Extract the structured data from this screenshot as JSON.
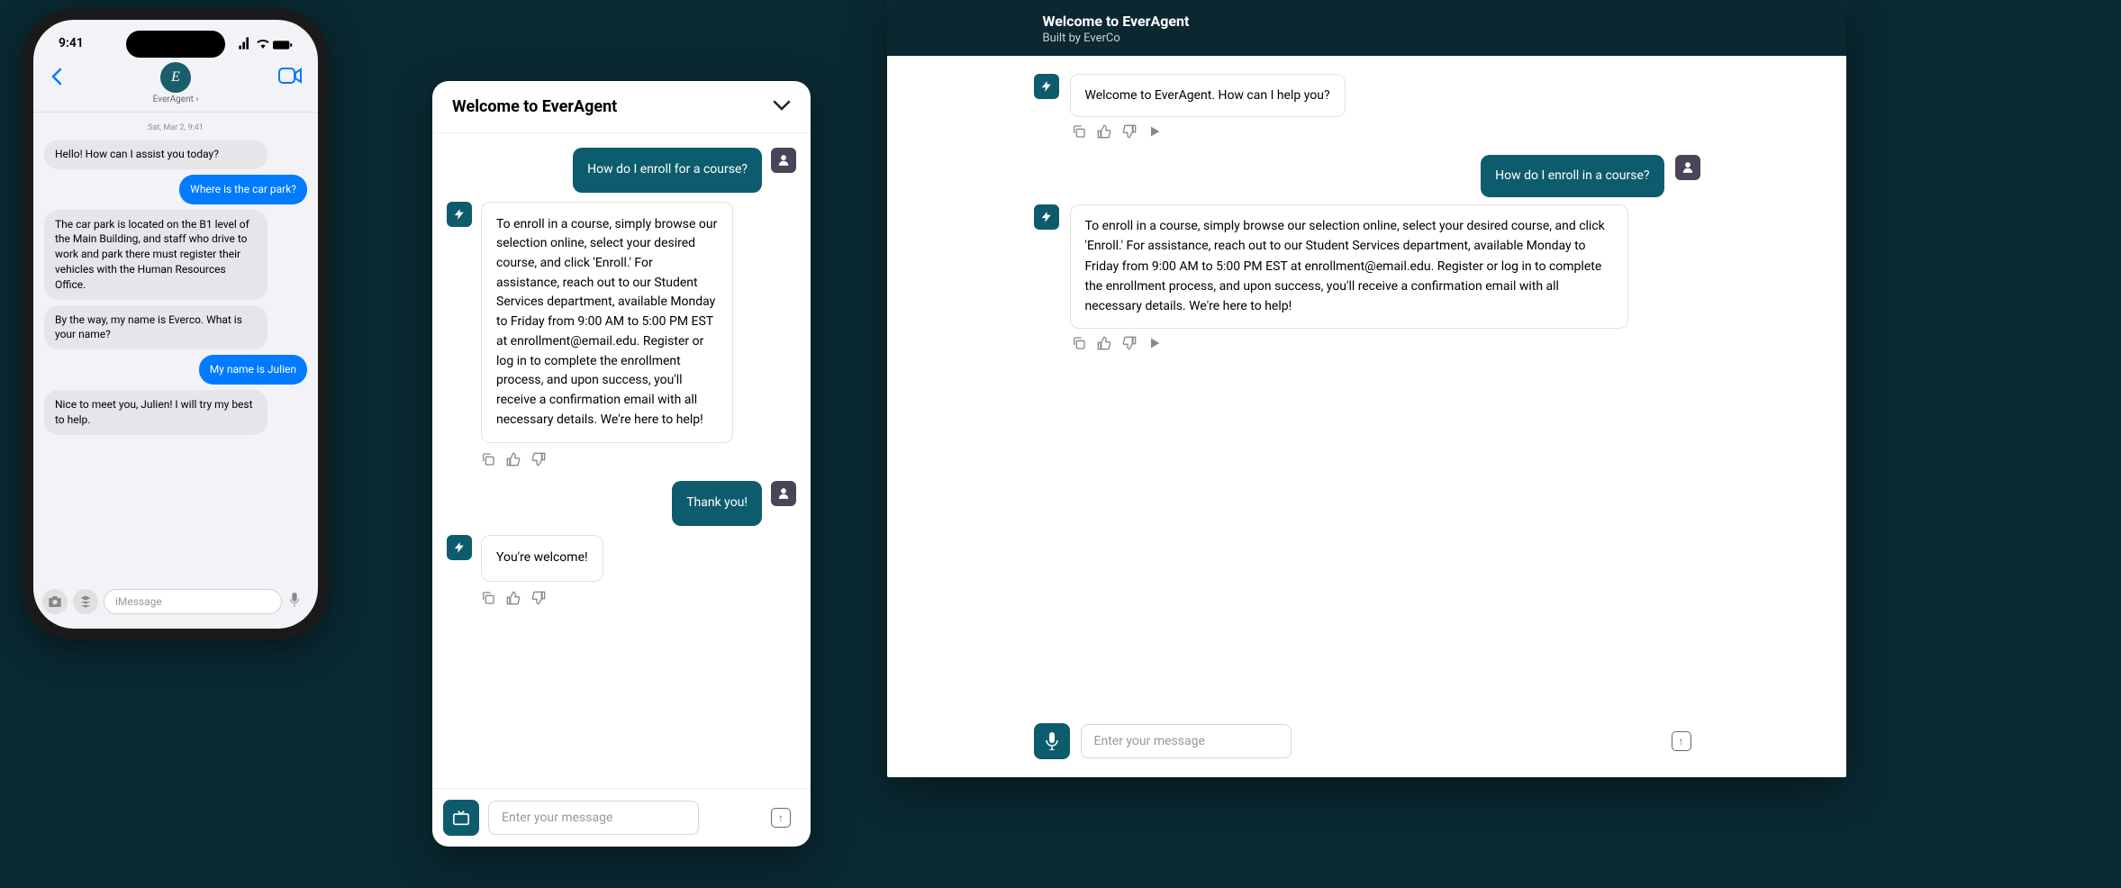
{
  "colors": {
    "accent": "#0d5c6e",
    "ios_blue": "#007aff",
    "bubble_gray": "#e5e5ea",
    "dark_bg": "#0b2730"
  },
  "phone": {
    "status_time": "9:41",
    "contact_name": "EverAgent",
    "date": "Sat, Mar 2, 9:41",
    "messages": [
      {
        "role": "in",
        "text": "Hello! How can I assist you today?"
      },
      {
        "role": "out",
        "text": "Where is the car park?"
      },
      {
        "role": "in",
        "text": "The car park is located on the B1 level of the Main Building, and staff who drive to work and park there must register their vehicles with the Human Resources Office."
      },
      {
        "role": "in",
        "text": "By the way, my name is Everco. What is your name?"
      },
      {
        "role": "out",
        "text": "My name is Julien"
      },
      {
        "role": "in",
        "text": "Nice to meet you, Julien! I will try my best to help."
      }
    ],
    "input_placeholder": "iMessage"
  },
  "widget": {
    "title": "Welcome to EverAgent",
    "messages": [
      {
        "role": "user",
        "text": "How do I enroll for a course?"
      },
      {
        "role": "agent",
        "text": "To enroll in a course, simply browse our selection online, select your desired course, and click 'Enroll.' For assistance, reach out to our Student Services department, available Monday to Friday from 9:00 AM to 5:00 PM EST at enrollment@email.edu. Register or log in to complete the enrollment process, and upon success, you'll receive a confirmation email with all necessary details. We're here to help!"
      },
      {
        "role": "user",
        "text": "Thank you!"
      },
      {
        "role": "agent",
        "text": "You're welcome!"
      }
    ],
    "input_placeholder": "Enter your message"
  },
  "panel": {
    "title": "Welcome to EverAgent",
    "subtitle": "Built by EverCo",
    "messages": [
      {
        "role": "agent",
        "text": "Welcome to EverAgent. How can I help you?"
      },
      {
        "role": "user",
        "text": "How do I enroll in a course?"
      },
      {
        "role": "agent",
        "text": "To enroll in a course, simply browse our selection online, select your desired course, and click 'Enroll.' For assistance, reach out to our Student Services department, available Monday to Friday from 9:00 AM to 5:00 PM EST at enrollment@email.edu. Register or log in to complete the enrollment process, and upon success, you'll receive a confirmation email with all necessary details. We're here to help!"
      }
    ],
    "input_placeholder": "Enter your message"
  },
  "icons": {
    "bolt": "bolt-icon",
    "person": "person-icon",
    "copy": "copy-icon",
    "thumbs_up": "thumbs-up-icon",
    "thumbs_down": "thumbs-down-icon",
    "play": "play-icon",
    "mic": "microphone-icon",
    "tv": "tv-icon",
    "send": "send-icon",
    "chevron_down": "chevron-down-icon",
    "back": "back-icon",
    "video": "video-icon",
    "camera": "camera-icon",
    "apps": "apps-icon"
  }
}
